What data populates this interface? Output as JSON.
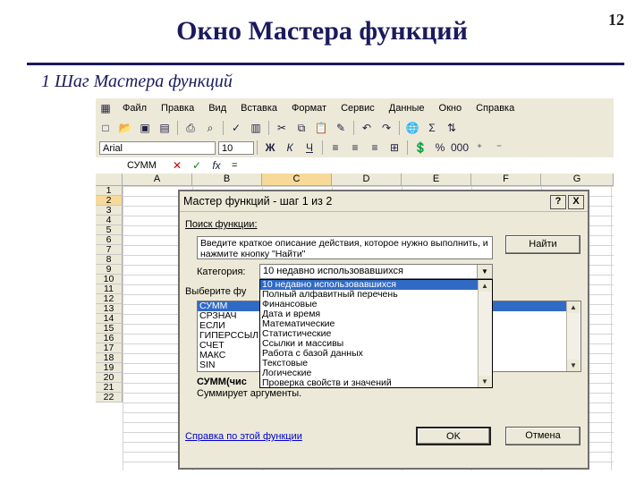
{
  "slide": {
    "title": "Окно Мастера функций",
    "page_number": "12",
    "subtitle": "1 Шаг Мастера функций"
  },
  "excel": {
    "menu": [
      "Файл",
      "Правка",
      "Вид",
      "Вставка",
      "Формат",
      "Сервис",
      "Данные",
      "Окно",
      "Справка"
    ],
    "font_name": "Arial",
    "font_size": "10",
    "name_box": "СУММ",
    "formula_symbol": "fx",
    "formula_value": "=",
    "columns": [
      "A",
      "B",
      "C",
      "D",
      "E",
      "F",
      "G"
    ],
    "rows": [
      "1",
      "2",
      "3",
      "4",
      "5",
      "6",
      "7",
      "8",
      "9",
      "10",
      "11",
      "12",
      "13",
      "14",
      "15",
      "16",
      "17",
      "18",
      "19",
      "20",
      "21",
      "22"
    ]
  },
  "dialog": {
    "title": "Мастер функций - шаг 1 из 2",
    "help_btn": "?",
    "close_btn": "X",
    "search_label": "Поиск функции:",
    "search_text": "Введите краткое описание действия, которое нужно выполнить, и нажмите кнопку \"Найти\"",
    "find_button": "Найти",
    "category_label": "Категория:",
    "category_value": "10 недавно использовавшихся",
    "choose_label": "Выберите фу",
    "categories": [
      "10 недавно использовавшихся",
      "Полный алфавитный перечень",
      "Финансовые",
      "Дата и время",
      "Математические",
      "Статистические",
      "Ссылки и массивы",
      "Работа с базой данных",
      "Текстовые",
      "Логические",
      "Проверка свойств и значений"
    ],
    "functions": [
      "СУММ",
      "СРЗНАЧ",
      "ЕСЛИ",
      "ГИПЕРССЫЛ",
      "СЧЕТ",
      "МАКС",
      "SIN"
    ],
    "signature": "СУММ(чис",
    "description": "Суммирует аргументы.",
    "help_link": "Справка по этой функции",
    "ok_button": "OK",
    "cancel_button": "Отмена"
  }
}
